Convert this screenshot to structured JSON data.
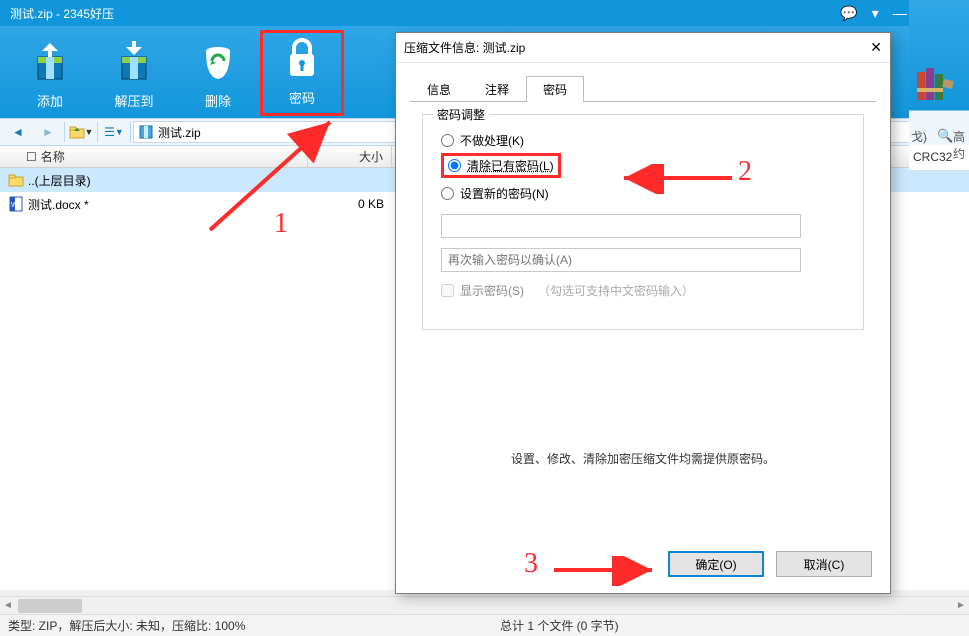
{
  "title": "测试.zip - 2345好压",
  "toolbar": {
    "add": "添加",
    "extract": "解压到",
    "delete": "删除",
    "password": "密码"
  },
  "path": {
    "file": "测试.zip"
  },
  "columns": {
    "name": "名称",
    "size": "大小"
  },
  "rows": {
    "up": "..(上层目录)",
    "file1_name": "测试.docx *",
    "file1_size": "0 KB"
  },
  "right_clip": {
    "label1": "戈)",
    "label2": "高约",
    "crc": "CRC32"
  },
  "status": {
    "left": "类型:  ZIP，解压后大小:  未知，压缩比:  100%",
    "right": "总计 1 个文件 (0 字节)"
  },
  "dialog": {
    "title": "压缩文件信息: 测试.zip",
    "tabs": {
      "info": "信息",
      "comment": "注释",
      "password": "密码"
    },
    "fieldset_legend": "密码调整",
    "radio_none": "不做处理(K)",
    "radio_clear": "清除已有密码(L)",
    "radio_set": "设置新的密码(N)",
    "pw_placeholder2": "再次输入密码以确认(A)",
    "chk_show": "显示密码(S)",
    "chk_hint": "（勾选可支持中文密码输入）",
    "note": "设置、修改、清除加密压缩文件均需提供原密码。",
    "ok": "确定(O)",
    "cancel": "取消(C)"
  },
  "annotations": {
    "n1": "1",
    "n2": "2",
    "n3": "3"
  }
}
